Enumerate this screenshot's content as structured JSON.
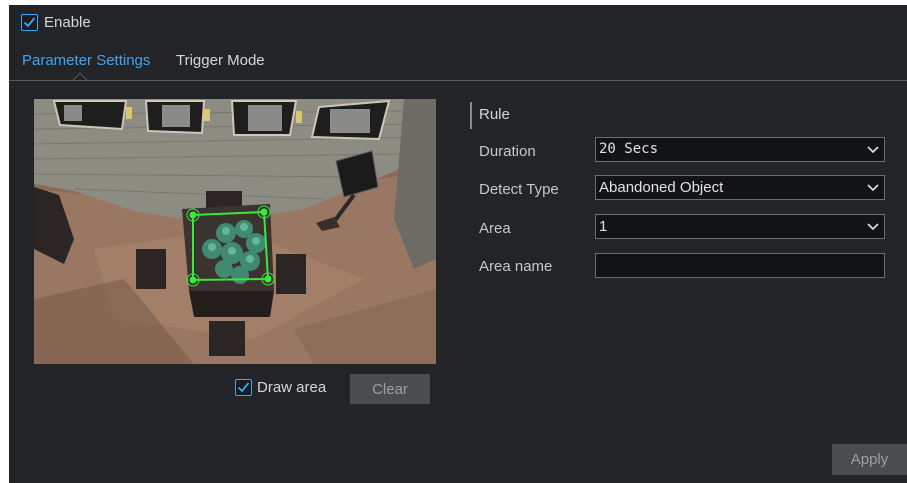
{
  "enable": {
    "label": "Enable",
    "checked": true
  },
  "tabs": [
    {
      "label": "Parameter Settings",
      "active": true
    },
    {
      "label": "Trigger Mode",
      "active": false
    }
  ],
  "preview": {
    "draw_area_label": "Draw area",
    "draw_area_checked": true,
    "clear_label": "Clear"
  },
  "form": {
    "section_title": "Rule",
    "fields": [
      {
        "label": "Duration",
        "value": "20 Secs",
        "kind": "select"
      },
      {
        "label": "Detect Type",
        "value": "Abandoned Object",
        "kind": "select"
      },
      {
        "label": "Area",
        "value": "1",
        "kind": "select"
      },
      {
        "label": "Area name",
        "value": "",
        "kind": "text"
      }
    ]
  },
  "apply_label": "Apply",
  "colors": {
    "accent": "#3da5f4",
    "panel": "#232427",
    "area_outline": "#38e83a"
  }
}
